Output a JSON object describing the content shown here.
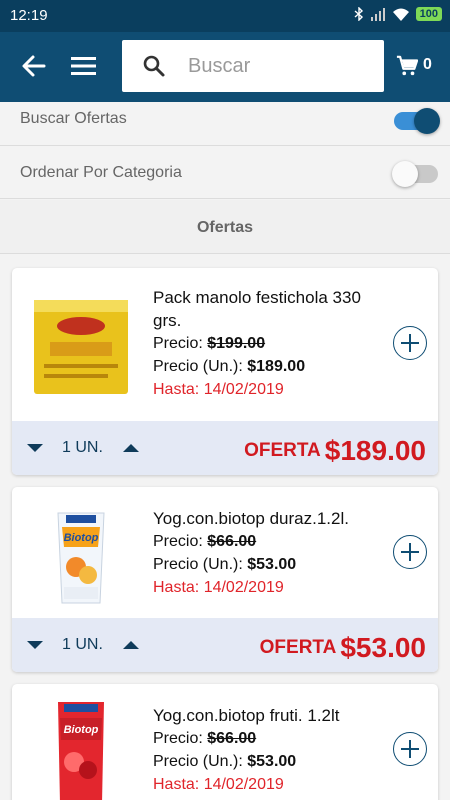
{
  "status_bar": {
    "time": "12:19",
    "battery": "100",
    "icons": [
      "bluetooth-icon",
      "signal-icon",
      "wifi-icon",
      "battery-icon"
    ]
  },
  "header": {
    "search": {
      "placeholder": "Buscar",
      "value": ""
    },
    "cart_count": "0",
    "icons": [
      "back-arrow-icon",
      "menu-icon",
      "search-icon",
      "cart-icon"
    ],
    "color": "#0f4d73"
  },
  "filters": {
    "buscar_ofertas": {
      "label": "Buscar Ofertas",
      "enabled": true
    },
    "ordenar_categoria": {
      "label": "Ordenar Por Categoria",
      "enabled": false
    }
  },
  "section_title": "Ofertas",
  "products": [
    {
      "name": "Pack manolo festichola 330 grs.",
      "price_label": "Precio:",
      "price_old": "$199.00",
      "unit_label": "Precio (Un.):",
      "unit_price": "$189.00",
      "until": "Hasta: 14/02/2019",
      "qty": "1 UN.",
      "offer_tag": "OFERTA",
      "offer_price": "$189.00"
    },
    {
      "name": "Yog.con.biotop duraz.1.2l.",
      "price_label": "Precio:",
      "price_old": "$66.00",
      "unit_label": "Precio (Un.):",
      "unit_price": "$53.00",
      "until": "Hasta: 14/02/2019",
      "qty": "1 UN.",
      "offer_tag": "OFERTA",
      "offer_price": "$53.00"
    },
    {
      "name": "Yog.con.biotop fruti. 1.2lt",
      "price_label": "Precio:",
      "price_old": "$66.00",
      "unit_label": "Precio (Un.):",
      "unit_price": "$53.00",
      "until": "Hasta: 14/02/2019"
    }
  ],
  "colors": {
    "offer_red": "#d11a20",
    "until_red": "#e0242a",
    "footer_bg": "#e4e9f5",
    "toggle_on": "#3a8fd6"
  }
}
